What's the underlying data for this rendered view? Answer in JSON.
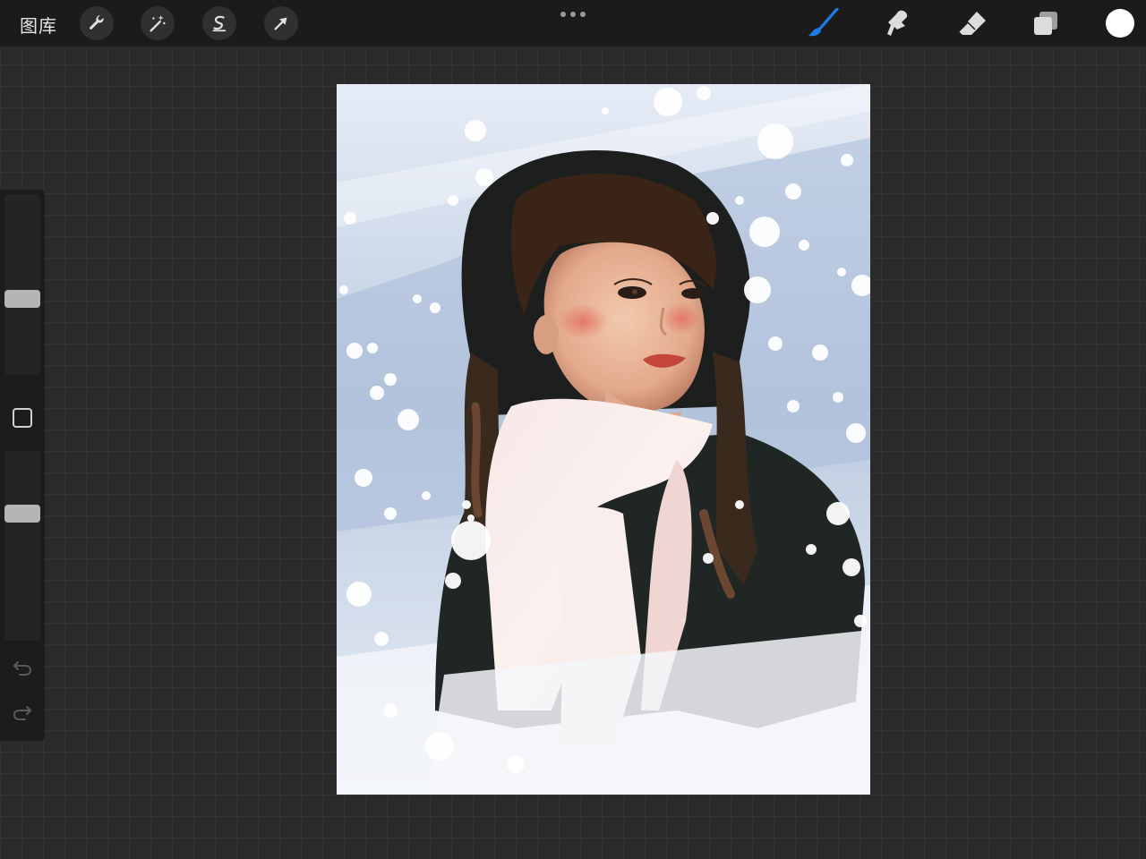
{
  "topbar": {
    "gallery_label": "图库",
    "left_tools": [
      {
        "name": "actions",
        "icon": "wrench-icon"
      },
      {
        "name": "adjustments",
        "icon": "magic-wand-icon"
      },
      {
        "name": "selection",
        "icon": "selection-s-icon"
      },
      {
        "name": "transform",
        "icon": "arrow-cursor-icon"
      }
    ],
    "more_icon": "more-dots-icon",
    "right_tools": [
      {
        "name": "brush",
        "icon": "brush-icon",
        "active": true,
        "color": "#1e7ce8"
      },
      {
        "name": "smudge",
        "icon": "smudge-icon",
        "active": false
      },
      {
        "name": "eraser",
        "icon": "eraser-icon",
        "active": false
      },
      {
        "name": "layers",
        "icon": "layers-icon",
        "active": false
      }
    ],
    "current_color": "#ffffff"
  },
  "sidebar": {
    "brush_size": 0.41,
    "opacity": 0.69,
    "modifier_icon": "square-modifier-icon",
    "undo_icon": "undo-icon",
    "redo_icon": "redo-icon"
  },
  "canvas": {
    "subject": "painted-portrait-girl-in-snow"
  },
  "colors": {
    "topbar_bg": "#1b1b1b",
    "workspace_bg": "#2a2a2a",
    "accent": "#1e7ce8"
  }
}
